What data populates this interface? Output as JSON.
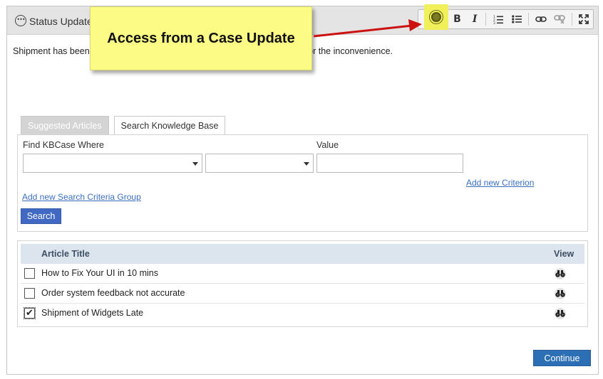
{
  "panel": {
    "title": "Status Update",
    "editor_text": "Shipment has been delayed to your account, see attached. Our apologies for the inconvenience."
  },
  "toolbar": {
    "buttons": [
      {
        "name": "knowledge-base",
        "icon": "knowledge-base-icon"
      },
      {
        "name": "bold",
        "label": "B"
      },
      {
        "name": "italic",
        "label": "I"
      },
      {
        "name": "numbered-list",
        "icon": "numbered-list-icon"
      },
      {
        "name": "bulleted-list",
        "icon": "bulleted-list-icon"
      },
      {
        "name": "link",
        "icon": "link-icon"
      },
      {
        "name": "unlink",
        "icon": "unlink-icon"
      },
      {
        "name": "fullscreen",
        "icon": "expand-icon"
      }
    ],
    "highlight_color": "#f2f05a"
  },
  "callout": {
    "text": "Access from a Case Update",
    "background": "#fbfb86",
    "arrow_color": "#cc1111"
  },
  "tabs": [
    {
      "label": "Suggested Articles",
      "active": false
    },
    {
      "label": "Search Knowledge Base",
      "active": true
    }
  ],
  "search": {
    "find_label": "Find KBCase Where",
    "value_label": "Value",
    "field_select_value": "",
    "operator_select_value": "",
    "value_input": "",
    "add_criterion_link": "Add new Criterion",
    "add_group_link": "Add new Search Criteria Group",
    "search_button": "Search"
  },
  "results": {
    "columns": [
      "Article Title",
      "View"
    ],
    "rows": [
      {
        "title": "How to Fix Your UI in 10 mins",
        "checked": false,
        "check_mark": ""
      },
      {
        "title": "Order system feedback not accurate",
        "checked": false,
        "check_mark": ""
      },
      {
        "title": "Shipment of Widgets Late",
        "checked": true,
        "check_mark": "✔"
      }
    ]
  },
  "footer": {
    "continue_button": "Continue"
  },
  "colors": {
    "primary_button": "#2c6fb5",
    "search_button": "#4169c4",
    "link": "#3a6fbf",
    "table_header": "#dce5ee"
  }
}
